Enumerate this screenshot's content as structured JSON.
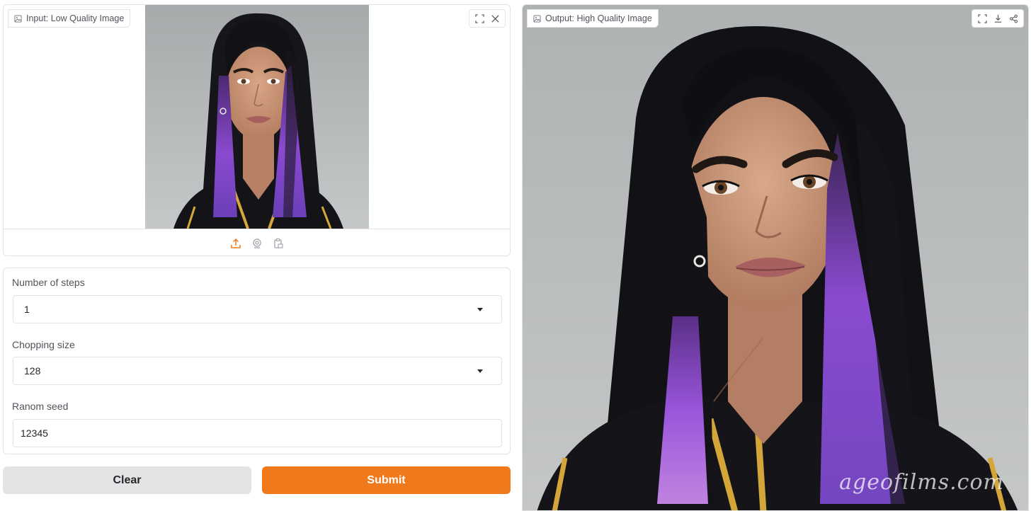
{
  "input_panel": {
    "label": "Input: Low Quality Image",
    "tools": [
      "fullscreen-icon",
      "close-icon"
    ],
    "sources": [
      "upload-icon",
      "webcam-icon",
      "clipboard-icon"
    ]
  },
  "controls": {
    "steps": {
      "label": "Number of steps",
      "value": "1"
    },
    "chop": {
      "label": "Chopping size",
      "value": "128"
    },
    "seed": {
      "label": "Ranom seed",
      "value": "12345"
    }
  },
  "buttons": {
    "clear": "Clear",
    "submit": "Submit"
  },
  "output_panel": {
    "label": "Output: High Quality Image",
    "tools": [
      "fullscreen-icon",
      "download-icon",
      "share-icon"
    ],
    "watermark": "ageofilms.com"
  },
  "colors": {
    "accent": "#f07a1b",
    "secondary_button": "#e4e4e7",
    "border": "#e4e4e7",
    "hair_purple": "#8a4ad0",
    "photo_background": "#b9bcbb"
  }
}
